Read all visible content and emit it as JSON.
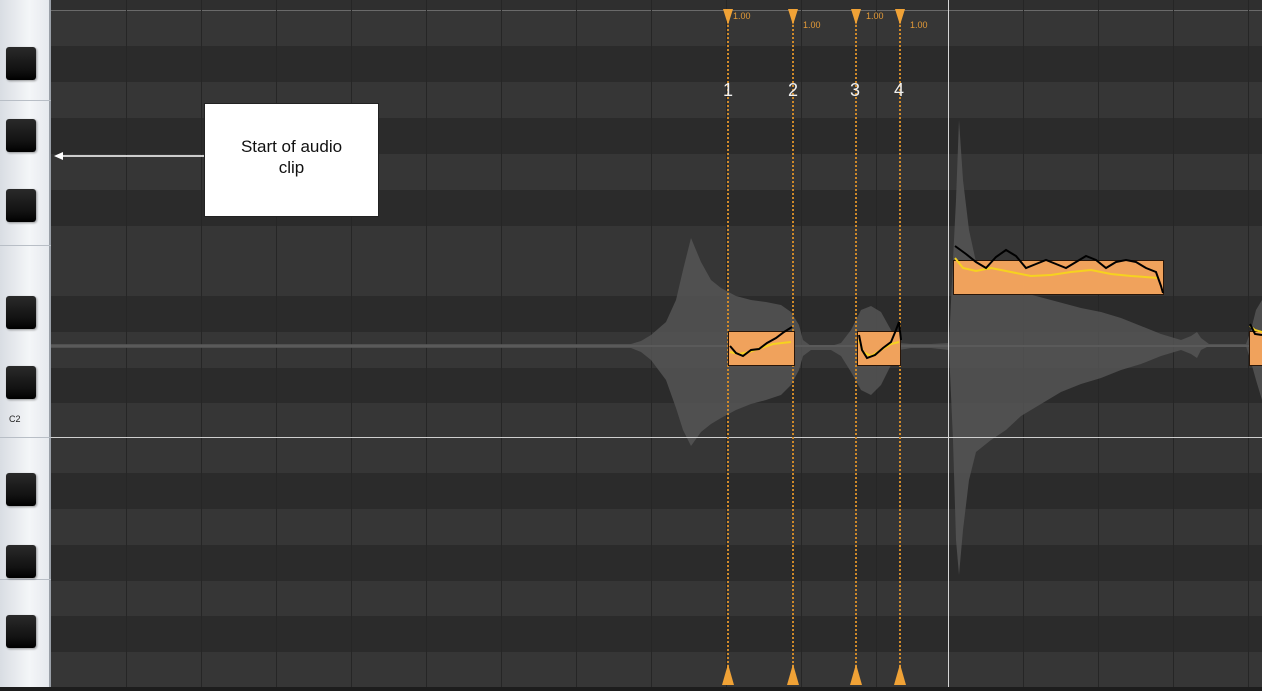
{
  "piano": {
    "c_label": "C2"
  },
  "markers": [
    {
      "number": "1",
      "value": "1.00"
    },
    {
      "number": "2",
      "value": "1.00"
    },
    {
      "number": "3",
      "value": "1.00"
    },
    {
      "number": "4",
      "value": "1.00"
    }
  ],
  "callout": {
    "text_line1": "Start of audio",
    "text_line2": "clip"
  },
  "colors": {
    "note_fill": "#f0a25c",
    "marker": "#f0a236",
    "pitch_curve_raw": "#000000",
    "pitch_curve_smoothed": "#f6d21f",
    "waveform": "#5a5a5a"
  }
}
